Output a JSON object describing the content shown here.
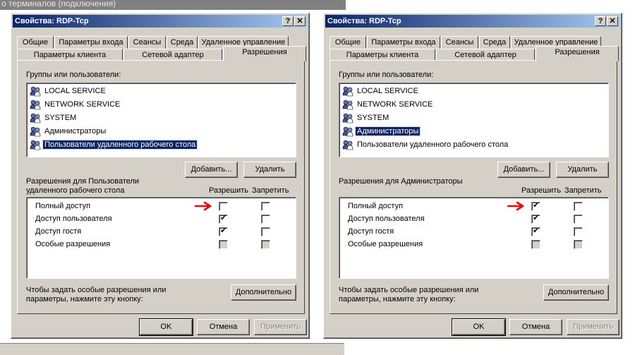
{
  "background": {
    "title": "о терминалов (подключения)"
  },
  "dialogs": [
    {
      "title": "Свойства: RDP-Tcp",
      "tabs_row1": [
        "Общие",
        "Параметры входа",
        "Сеансы",
        "Среда",
        "Удаленное управление"
      ],
      "tabs_row2": [
        "Параметры клиента",
        "Сетевой адаптер",
        "Разрешения"
      ],
      "groups_label": "Группы или пользователи:",
      "users": [
        "LOCAL SERVICE",
        "NETWORK SERVICE",
        "SYSTEM",
        "Администраторы",
        "Пользователи удаленного рабочего стола"
      ],
      "selected_index": 4,
      "add_button": "Добавить...",
      "remove_button": "Удалить",
      "perm_label_line1": "Разрешения для Пользователи",
      "perm_label_line2": "удаленного рабочего стола",
      "allow_header": "Разрешить",
      "deny_header": "Запретить",
      "permissions": [
        {
          "name": "Полный доступ",
          "allow": false,
          "deny": false,
          "grey": false
        },
        {
          "name": "Доступ пользователя",
          "allow": true,
          "deny": false,
          "grey": false
        },
        {
          "name": "Доступ гостя",
          "allow": true,
          "deny": false,
          "grey": false
        },
        {
          "name": "Особые разрешения",
          "allow": false,
          "deny": false,
          "grey": true
        }
      ],
      "advanced_hint_line1": "Чтобы задать особые разрешения или",
      "advanced_hint_line2": "параметры, нажмите эту кнопку:",
      "advanced_button": "Дополнительно",
      "ok_button": "OK",
      "cancel_button": "Отмена",
      "apply_button": "Применить",
      "help_glyph": "?",
      "close_glyph": "✕",
      "arrow_color": "#ff0000"
    },
    {
      "title": "Свойства: RDP-Tcp",
      "tabs_row1": [
        "Общие",
        "Параметры входа",
        "Сеансы",
        "Среда",
        "Удаленное управление"
      ],
      "tabs_row2": [
        "Параметры клиента",
        "Сетевой адаптер",
        "Разрешения"
      ],
      "groups_label": "Группы или пользователи:",
      "users": [
        "LOCAL SERVICE",
        "NETWORK SERVICE",
        "SYSTEM",
        "Администраторы",
        "Пользователи удаленного рабочего стола"
      ],
      "selected_index": 3,
      "add_button": "Добавить...",
      "remove_button": "Удалить",
      "perm_label_line1": "Разрешения для Администраторы",
      "perm_label_line2": "",
      "allow_header": "Разрешить",
      "deny_header": "Запретить",
      "permissions": [
        {
          "name": "Полный доступ",
          "allow": true,
          "deny": false,
          "grey": false
        },
        {
          "name": "Доступ пользователя",
          "allow": true,
          "deny": false,
          "grey": false
        },
        {
          "name": "Доступ гостя",
          "allow": true,
          "deny": false,
          "grey": false
        },
        {
          "name": "Особые разрешения",
          "allow": false,
          "deny": false,
          "grey": true
        }
      ],
      "advanced_hint_line1": "Чтобы задать особые разрешения или",
      "advanced_hint_line2": "параметры, нажмите эту кнопку:",
      "advanced_button": "Дополнительно",
      "ok_button": "OK",
      "cancel_button": "Отмена",
      "apply_button": "Применить",
      "help_glyph": "?",
      "close_glyph": "✕",
      "arrow_color": "#ff0000"
    }
  ],
  "icons": {
    "user_group": "users-group-icon",
    "arrow": "red-arrow-icon",
    "check": "✔"
  }
}
